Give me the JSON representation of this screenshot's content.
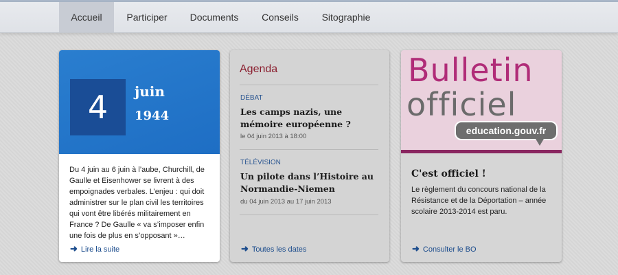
{
  "nav": {
    "items": [
      {
        "label": "Accueil",
        "active": true
      },
      {
        "label": "Participer",
        "active": false
      },
      {
        "label": "Documents",
        "active": false
      },
      {
        "label": "Conseils",
        "active": false
      },
      {
        "label": "Sitographie",
        "active": false
      }
    ]
  },
  "event_card": {
    "day": "4",
    "month": "juin",
    "year": "1944",
    "text": "Du 4 juin au 6 juin à l’aube, Churchill, de Gaulle et Eisenhower se livrent à des empoignades verbales. L’enjeu : qui doit administrer sur le plan civil les territoires qui vont être libérés militairement en France ? De Gaulle « va s’imposer enfin une fois de plus en s’opposant »…",
    "link": "Lire la suite"
  },
  "agenda": {
    "title": "Agenda",
    "events": [
      {
        "type": "DÉBAT",
        "title": "Les camps nazis, une mémoire européenne ?",
        "date": "le 04 juin 2013 à 18:00"
      },
      {
        "type": "TÉLÉVISION",
        "title": "Un pilote dans l’Histoire au Normandie-Niemen",
        "date": "du 04 juin 2013 au 17 juin 2013"
      }
    ],
    "link": "Toutes les dates"
  },
  "bo_card": {
    "logo_line1": "Bulletin",
    "logo_line2": "officiel",
    "logo_site": "education.gouv.fr",
    "heading": "C'est officiel !",
    "text": "Le règlement du concours national de la Résistance et de la Déportation – année scolaire 2013-2014 est paru.",
    "link": "Consulter le BO"
  },
  "colors": {
    "accent_blue": "#1e6ec4",
    "agenda_title": "#8a1e2e",
    "bo_pink": "#b02c78",
    "link": "#1a4b8c"
  },
  "icons": {
    "arrow": "arrow-right-icon"
  }
}
